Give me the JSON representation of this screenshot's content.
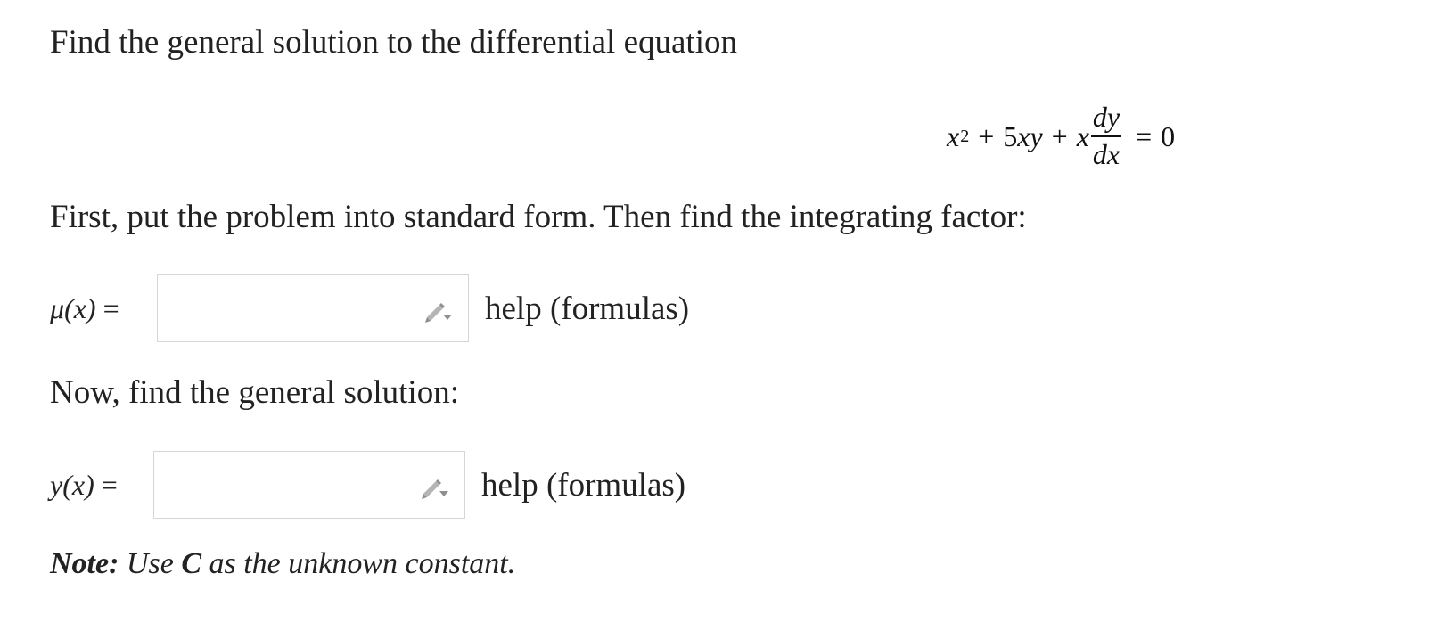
{
  "problem": {
    "intro": "Find the general solution to the differential equation",
    "equation": {
      "term1_var": "x",
      "term1_exp": "2",
      "plus1": "+",
      "term2": "5xy",
      "plus2": "+",
      "term3": "x",
      "frac_num": "dy",
      "frac_den": "dx",
      "equals": "=",
      "rhs": "0"
    },
    "instruction": "First, put the problem into standard form. Then find the integrating factor:",
    "solution_prompt": "Now, find the general solution:"
  },
  "answers": {
    "mu": {
      "label": "μ(x)",
      "equals": "=",
      "value": "",
      "help_label": "help (formulas)"
    },
    "y": {
      "label": "y(x)",
      "equals": "=",
      "value": "",
      "help_label": "help (formulas)"
    }
  },
  "note": {
    "label": "Note:",
    "text_before": " Use ",
    "constant": "C",
    "text_after": " as the unknown constant."
  },
  "icons": {
    "pencil": "pencil-dropdown-icon"
  },
  "colors": {
    "text": "#222222",
    "box_border": "#d6d6d6",
    "icon": "#9a9a9a"
  }
}
